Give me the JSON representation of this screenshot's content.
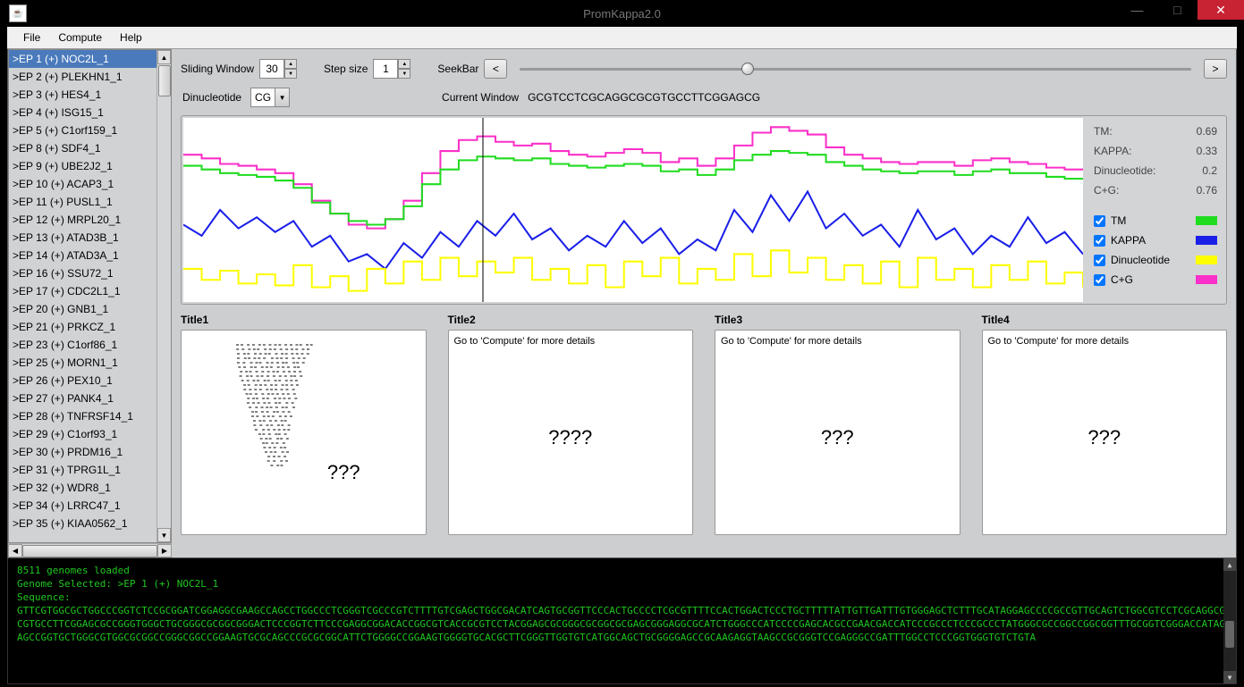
{
  "window": {
    "title": "PromKappa2.0",
    "min_label": "—",
    "max_label": "□",
    "close_label": "✕"
  },
  "menu": {
    "items": [
      "File",
      "Compute",
      "Help"
    ]
  },
  "list": {
    "items": [
      ">EP 1 (+) NOC2L_1",
      ">EP 2 (+) PLEKHN1_1",
      ">EP 3 (+) HES4_1",
      ">EP 4 (+) ISG15_1",
      ">EP 5 (+) C1orf159_1",
      ">EP 8 (+) SDF4_1",
      ">EP 9 (+) UBE2J2_1",
      ">EP 10 (+) ACAP3_1",
      ">EP 11 (+) PUSL1_1",
      ">EP 12 (+) MRPL20_1",
      ">EP 13 (+) ATAD3B_1",
      ">EP 14 (+) ATAD3A_1",
      ">EP 16 (+) SSU72_1",
      ">EP 17 (+) CDC2L1_1",
      ">EP 20 (+) GNB1_1",
      ">EP 21 (+) PRKCZ_1",
      ">EP 23 (+) C1orf86_1",
      ">EP 25 (+) MORN1_1",
      ">EP 26 (+) PEX10_1",
      ">EP 27 (+) PANK4_1",
      ">EP 28 (+) TNFRSF14_1",
      ">EP 29 (+) C1orf93_1",
      ">EP 30 (+) PRDM16_1",
      ">EP 31 (+) TPRG1L_1",
      ">EP 32 (+) WDR8_1",
      ">EP 34 (+) LRRC47_1",
      ">EP 35 (+) KIAA0562_1"
    ],
    "selected_index": 0
  },
  "controls": {
    "sliding_window_label": "Sliding Window",
    "sliding_window_value": "30",
    "step_size_label": "Step size",
    "step_size_value": "1",
    "seekbar_label": "SeekBar",
    "seek_prev": "<",
    "seek_next": ">",
    "seek_position_pct": 33,
    "dinucleotide_label": "Dinucleotide",
    "dinucleotide_value": "CG",
    "current_window_label": "Current Window",
    "current_window_value": "GCGTCCTCGCAGGCGCGTGCCTTCGGAGCG"
  },
  "stats": {
    "tm_label": "TM:",
    "tm_value": "0.69",
    "kappa_label": "KAPPA:",
    "kappa_value": "0.33",
    "dinuc_label": "Dinucleotide:",
    "dinuc_value": "0.2",
    "cg_label": "C+G:",
    "cg_value": "0.76"
  },
  "legend": {
    "tm": {
      "label": "TM",
      "color": "#1fdc1f",
      "checked": true
    },
    "kappa": {
      "label": "KAPPA",
      "color": "#1a1fe8",
      "checked": true
    },
    "dinuc": {
      "label": "Dinucleotide",
      "color": "#fdfd00",
      "checked": true
    },
    "cg": {
      "label": "C+G",
      "color": "#fb2fc9",
      "checked": true
    }
  },
  "panels": {
    "p1": {
      "title": "Title1",
      "big": "???"
    },
    "p2": {
      "title": "Title2",
      "hint": "Go to 'Compute' for more details",
      "big": "????"
    },
    "p3": {
      "title": "Title3",
      "hint": "Go to 'Compute' for more details",
      "big": "???"
    },
    "p4": {
      "title": "Title4",
      "hint": "Go to 'Compute' for more details",
      "big": "???"
    }
  },
  "console": {
    "lines": [
      "8511 genomes loaded",
      "Genome Selected: >EP 1 (+) NOC2L_1",
      "Sequence:",
      "GTTCGTGGCGCTGGCCCGGTCTCCGCGGATCGGAGGCGAAGCCAGCCTGGCCCTCGGGTCGCCCGTCTTTTGTCGAGCTGGCGACATCAGTGCGGTTCCCACTGCCCCTCGCGTTTTCCACTGGACTCCCTGCTTTTTATTGTTGATTTGTGGGAGCTCTTTGCATAGGAGCCCCGCCGTTGCAGTCTGGCGTCCTCGCAGGCGCGTGCCTTCGGAGCGCCGGGTGGGCTGCGGGCGCGGCGGGACTCCCGGTCTTCCCGAGGCGGACACCGGCGTCACCGCGTCCTACGGAGCGCGGGCGCGGCGCGAGCGGGAGGCGCATCTGGGCCCATCCCCGAGCACGCCGAACGACCATCCCGCCCTCCCGCCCTATGGGCGCCGGCCGGCGGTTTGCGGTCGGGACCATAGAGCCGGTGCTGGGCGTGGCGCGGCCGGGCGGCCGGAAGTGCGCAGCCCGCGCGGCATTCTGGGGCCGGAAGTGGGGTGCACGCTTCGGGTTGGTGTCATGGCAGCTGCGGGGAGCCGCAAGAGGTAAGCCGCGGGTCCGAGGGCCGATTTGGCCTCCCGGTGGGTGTCTGTA"
    ]
  },
  "chart_data": {
    "type": "line",
    "xrange": [
      0,
      1000
    ],
    "yrange": [
      0,
      1
    ],
    "cursor_x": 333,
    "series": [
      {
        "name": "C+G",
        "color": "#fb2fc9",
        "step": true,
        "y": [
          0.8,
          0.78,
          0.75,
          0.74,
          0.72,
          0.7,
          0.64,
          0.55,
          0.48,
          0.42,
          0.4,
          0.45,
          0.55,
          0.7,
          0.82,
          0.88,
          0.9,
          0.87,
          0.85,
          0.86,
          0.82,
          0.8,
          0.79,
          0.81,
          0.83,
          0.81,
          0.76,
          0.78,
          0.74,
          0.78,
          0.85,
          0.92,
          0.95,
          0.93,
          0.91,
          0.84,
          0.8,
          0.78,
          0.76,
          0.75,
          0.76,
          0.76,
          0.74,
          0.77,
          0.78,
          0.76,
          0.75,
          0.73,
          0.72,
          0.72
        ]
      },
      {
        "name": "TM",
        "color": "#1fdc1f",
        "step": true,
        "y": [
          0.74,
          0.72,
          0.7,
          0.69,
          0.68,
          0.66,
          0.62,
          0.54,
          0.48,
          0.44,
          0.42,
          0.45,
          0.52,
          0.64,
          0.72,
          0.77,
          0.79,
          0.78,
          0.77,
          0.78,
          0.75,
          0.74,
          0.73,
          0.74,
          0.75,
          0.74,
          0.71,
          0.72,
          0.69,
          0.72,
          0.77,
          0.8,
          0.82,
          0.81,
          0.8,
          0.76,
          0.74,
          0.72,
          0.71,
          0.7,
          0.71,
          0.71,
          0.69,
          0.71,
          0.72,
          0.7,
          0.7,
          0.68,
          0.67,
          0.67
        ]
      },
      {
        "name": "KAPPA",
        "color": "#1a1fe8",
        "step": false,
        "y": [
          0.42,
          0.36,
          0.5,
          0.4,
          0.46,
          0.38,
          0.44,
          0.3,
          0.36,
          0.22,
          0.26,
          0.18,
          0.32,
          0.24,
          0.38,
          0.3,
          0.44,
          0.36,
          0.48,
          0.34,
          0.4,
          0.28,
          0.36,
          0.3,
          0.44,
          0.32,
          0.4,
          0.26,
          0.34,
          0.28,
          0.5,
          0.38,
          0.58,
          0.44,
          0.6,
          0.4,
          0.48,
          0.36,
          0.42,
          0.3,
          0.5,
          0.34,
          0.4,
          0.26,
          0.36,
          0.3,
          0.46,
          0.32,
          0.38,
          0.26
        ]
      },
      {
        "name": "Dinucleotide",
        "color": "#fdfd00",
        "step": true,
        "y": [
          0.18,
          0.12,
          0.17,
          0.1,
          0.15,
          0.09,
          0.2,
          0.08,
          0.14,
          0.06,
          0.18,
          0.1,
          0.22,
          0.12,
          0.24,
          0.14,
          0.22,
          0.16,
          0.24,
          0.12,
          0.18,
          0.1,
          0.2,
          0.08,
          0.22,
          0.14,
          0.24,
          0.1,
          0.18,
          0.12,
          0.26,
          0.14,
          0.28,
          0.16,
          0.24,
          0.12,
          0.2,
          0.1,
          0.22,
          0.08,
          0.24,
          0.12,
          0.18,
          0.08,
          0.2,
          0.12,
          0.22,
          0.1,
          0.16,
          0.08
        ]
      }
    ]
  }
}
